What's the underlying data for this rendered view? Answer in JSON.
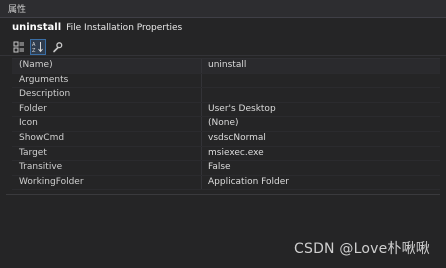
{
  "window": {
    "title": "属性"
  },
  "object": {
    "name": "uninstall",
    "type": "File Installation Properties"
  },
  "toolbar": {
    "buttons": [
      {
        "icon": "categorized-icon",
        "active": false
      },
      {
        "icon": "alphabetical-sort-icon",
        "active": true
      },
      {
        "icon": "property-pages-wrench-icon",
        "active": false
      }
    ]
  },
  "properties": [
    {
      "name": "(Name)",
      "value": "uninstall"
    },
    {
      "name": "Arguments",
      "value": ""
    },
    {
      "name": "Description",
      "value": ""
    },
    {
      "name": "Folder",
      "value": "User's Desktop"
    },
    {
      "name": "Icon",
      "value": "(None)"
    },
    {
      "name": "ShowCmd",
      "value": "vsdscNormal"
    },
    {
      "name": "Target",
      "value": "msiexec.exe"
    },
    {
      "name": "Transitive",
      "value": "False"
    },
    {
      "name": "WorkingFolder",
      "value": "Application Folder"
    }
  ],
  "watermark": "CSDN @Love朴啾啾",
  "colors": {
    "background": "#252526",
    "titlebar": "#2d2d30",
    "active_button_border": "#3a6ea5"
  }
}
